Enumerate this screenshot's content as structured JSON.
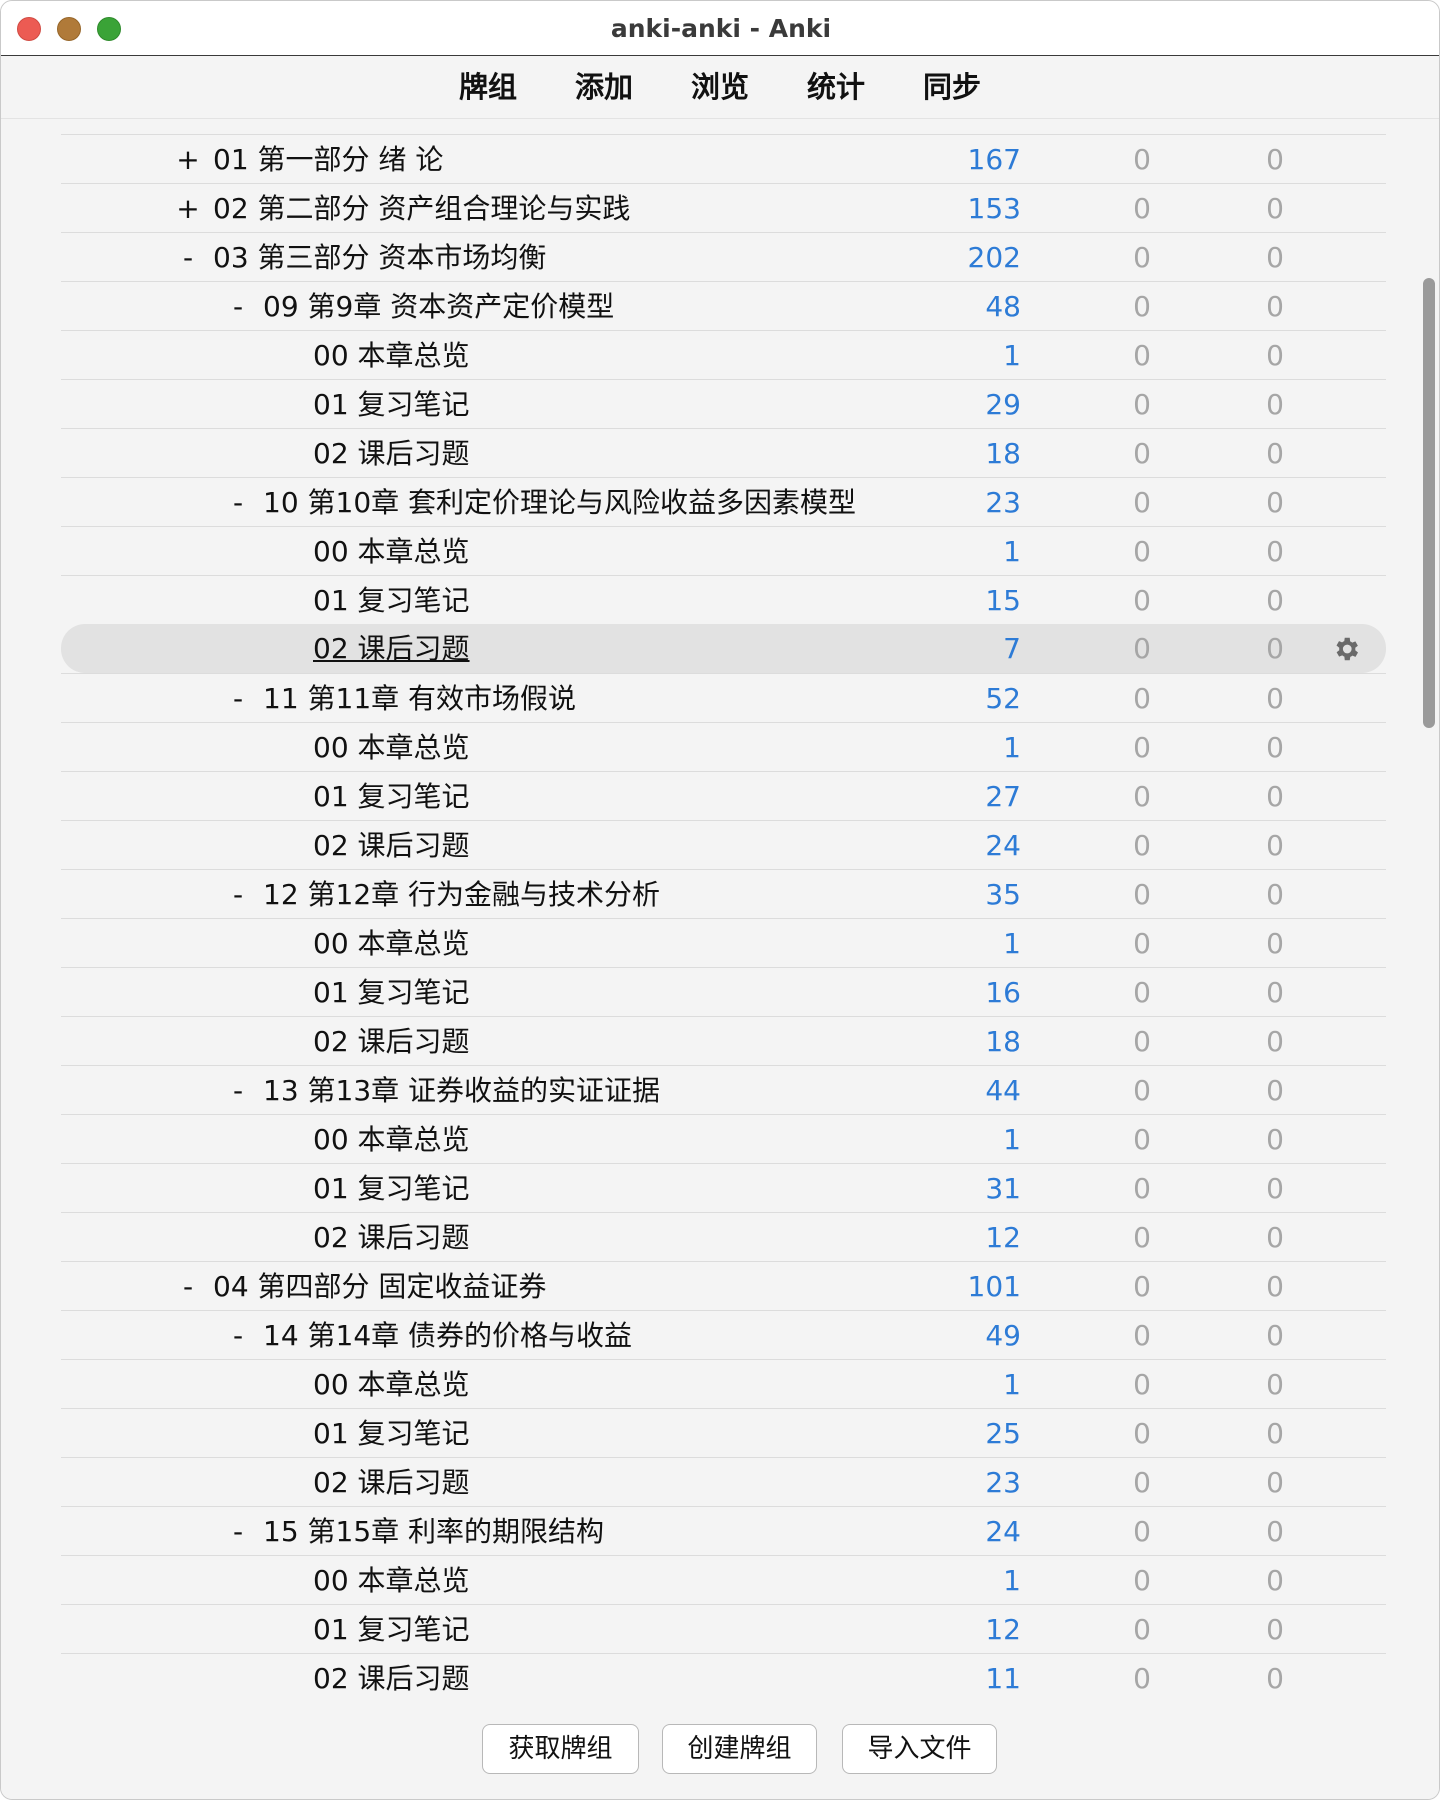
{
  "window": {
    "title": "anki-anki - Anki"
  },
  "toolbar": {
    "items": [
      "牌组",
      "添加",
      "浏览",
      "统计",
      "同步"
    ]
  },
  "decks": [
    {
      "collapse": "+",
      "name": "01 第一部分 绪 论",
      "new": "167",
      "learn": "0",
      "due": "0"
    },
    {
      "collapse": "+",
      "name": "02 第二部分 资产组合理论与实践",
      "new": "153",
      "learn": "0",
      "due": "0"
    },
    {
      "collapse": "-",
      "name": "03 第三部分 资本市场均衡",
      "new": "202",
      "learn": "0",
      "due": "0"
    },
    {
      "collapse": "-",
      "name": "09 第9章 资本资产定价模型",
      "new": "48",
      "learn": "0",
      "due": "0"
    },
    {
      "collapse": "",
      "name": "00 本章总览",
      "new": "1",
      "learn": "0",
      "due": "0"
    },
    {
      "collapse": "",
      "name": "01 复习笔记",
      "new": "29",
      "learn": "0",
      "due": "0"
    },
    {
      "collapse": "",
      "name": "02 课后习题",
      "new": "18",
      "learn": "0",
      "due": "0"
    },
    {
      "collapse": "-",
      "name": "10 第10章 套利定价理论与风险收益多因素模型",
      "new": "23",
      "learn": "0",
      "due": "0"
    },
    {
      "collapse": "",
      "name": "00 本章总览",
      "new": "1",
      "learn": "0",
      "due": "0"
    },
    {
      "collapse": "",
      "name": "01 复习笔记",
      "new": "15",
      "learn": "0",
      "due": "0"
    },
    {
      "collapse": "",
      "name": "02 课后习题",
      "new": "7",
      "learn": "0",
      "due": "0"
    },
    {
      "collapse": "-",
      "name": "11 第11章 有效市场假说",
      "new": "52",
      "learn": "0",
      "due": "0"
    },
    {
      "collapse": "",
      "name": "00 本章总览",
      "new": "1",
      "learn": "0",
      "due": "0"
    },
    {
      "collapse": "",
      "name": "01 复习笔记",
      "new": "27",
      "learn": "0",
      "due": "0"
    },
    {
      "collapse": "",
      "name": "02 课后习题",
      "new": "24",
      "learn": "0",
      "due": "0"
    },
    {
      "collapse": "-",
      "name": "12 第12章 行为金融与技术分析",
      "new": "35",
      "learn": "0",
      "due": "0"
    },
    {
      "collapse": "",
      "name": "00 本章总览",
      "new": "1",
      "learn": "0",
      "due": "0"
    },
    {
      "collapse": "",
      "name": "01 复习笔记",
      "new": "16",
      "learn": "0",
      "due": "0"
    },
    {
      "collapse": "",
      "name": "02 课后习题",
      "new": "18",
      "learn": "0",
      "due": "0"
    },
    {
      "collapse": "-",
      "name": "13 第13章 证券收益的实证证据",
      "new": "44",
      "learn": "0",
      "due": "0"
    },
    {
      "collapse": "",
      "name": "00 本章总览",
      "new": "1",
      "learn": "0",
      "due": "0"
    },
    {
      "collapse": "",
      "name": "01 复习笔记",
      "new": "31",
      "learn": "0",
      "due": "0"
    },
    {
      "collapse": "",
      "name": "02 课后习题",
      "new": "12",
      "learn": "0",
      "due": "0"
    },
    {
      "collapse": "-",
      "name": "04 第四部分 固定收益证券",
      "new": "101",
      "learn": "0",
      "due": "0"
    },
    {
      "collapse": "-",
      "name": "14 第14章 债券的价格与收益",
      "new": "49",
      "learn": "0",
      "due": "0"
    },
    {
      "collapse": "",
      "name": "00 本章总览",
      "new": "1",
      "learn": "0",
      "due": "0"
    },
    {
      "collapse": "",
      "name": "01 复习笔记",
      "new": "25",
      "learn": "0",
      "due": "0"
    },
    {
      "collapse": "",
      "name": "02 课后习题",
      "new": "23",
      "learn": "0",
      "due": "0"
    },
    {
      "collapse": "-",
      "name": "15 第15章 利率的期限结构",
      "new": "24",
      "learn": "0",
      "due": "0"
    },
    {
      "collapse": "",
      "name": "00 本章总览",
      "new": "1",
      "learn": "0",
      "due": "0"
    },
    {
      "collapse": "",
      "name": "01 复习笔记",
      "new": "12",
      "learn": "0",
      "due": "0"
    },
    {
      "collapse": "",
      "name": "02 课后习题",
      "new": "11",
      "learn": "0",
      "due": "0"
    }
  ],
  "current_deck_index": 10,
  "footer": {
    "get_shared": "获取牌组",
    "create_deck": "创建牌组",
    "import_file": "导入文件"
  },
  "colors": {
    "new_count": "#2d7bd6",
    "zero_count": "#a6a6a6"
  }
}
